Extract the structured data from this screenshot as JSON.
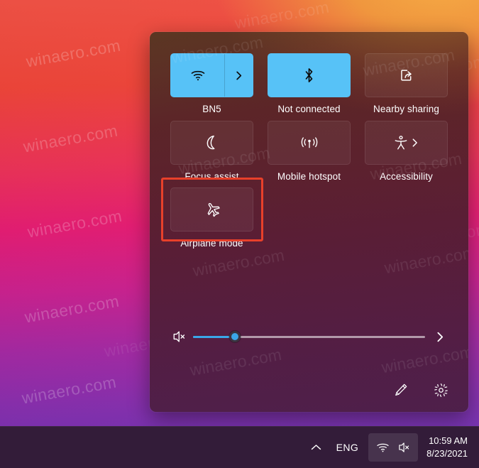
{
  "wallpaper": {
    "watermark_text": "winaero.com"
  },
  "quick_settings": {
    "tiles": [
      {
        "id": "wifi",
        "label": "BN5",
        "icon": "wifi-icon",
        "state": "on",
        "has_chevron": true,
        "split": true
      },
      {
        "id": "bluetooth",
        "label": "Not connected",
        "icon": "bluetooth-icon",
        "state": "on",
        "has_chevron": false,
        "split": false
      },
      {
        "id": "nearby",
        "label": "Nearby sharing",
        "icon": "share-icon",
        "state": "off",
        "has_chevron": false,
        "split": false
      },
      {
        "id": "focus",
        "label": "Focus assist",
        "icon": "moon-icon",
        "state": "off",
        "has_chevron": false,
        "split": false
      },
      {
        "id": "hotspot",
        "label": "Mobile hotspot",
        "icon": "broadcast-icon",
        "state": "off",
        "has_chevron": false,
        "split": false
      },
      {
        "id": "accessibility",
        "label": "Accessibility",
        "icon": "accessibility-icon",
        "state": "off",
        "has_chevron": true,
        "split": false
      },
      {
        "id": "airplane",
        "label": "Airplane mode",
        "icon": "airplane-icon",
        "state": "off",
        "has_chevron": false,
        "split": false
      }
    ],
    "highlight": {
      "target": "airplane",
      "color": "#e8402a"
    },
    "volume": {
      "icon": "speaker-muted-icon",
      "value_percent": 18,
      "expand_icon": "chevron-right-icon"
    },
    "footer": {
      "edit_icon": "pencil-icon",
      "edit_label": "Edit quick settings",
      "settings_icon": "gear-icon",
      "settings_label": "All settings"
    }
  },
  "taskbar": {
    "show_hidden_icons_label": "Show hidden icons",
    "language": "ENG",
    "tray_icons": [
      "wifi-icon",
      "speaker-muted-icon"
    ],
    "clock": {
      "time": "10:59 AM",
      "date": "8/23/2021"
    }
  },
  "colors": {
    "accent_blue": "#57c2f7",
    "slider_blue": "#3aa7e8",
    "highlight_red": "#e8402a",
    "taskbar_bg": "#331c39"
  }
}
